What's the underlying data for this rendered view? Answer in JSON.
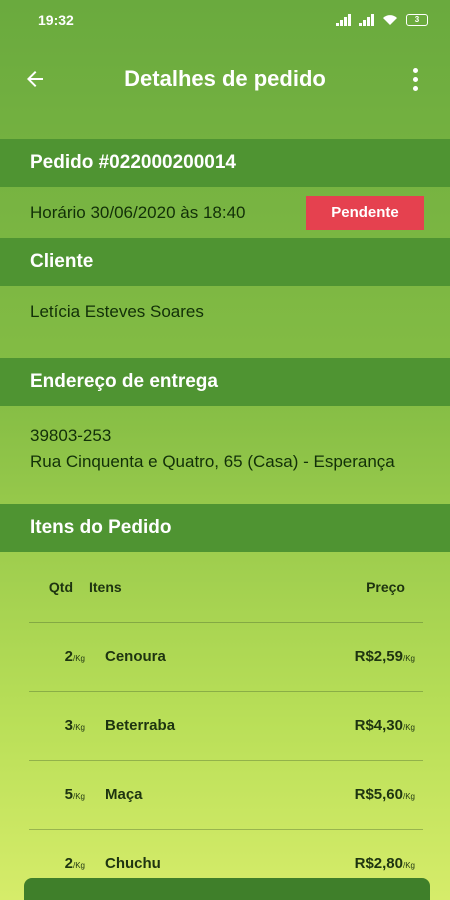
{
  "status_bar": {
    "time": "19:32",
    "battery": "3"
  },
  "app_bar": {
    "title": "Detalhes de pedido"
  },
  "order": {
    "title": "Pedido #022000200014",
    "time_label": "Horário 30/06/2020 às 18:40",
    "status": "Pendente",
    "status_color": "#e5414f"
  },
  "client": {
    "header": "Cliente",
    "name": "Letícia Esteves Soares"
  },
  "address": {
    "header": "Endereço de entrega",
    "zip": "39803-253",
    "street": "Rua Cinquenta e Quatro, 65 (Casa) - Esperança"
  },
  "items": {
    "header": "Itens do Pedido",
    "columns": {
      "qtd": "Qtd",
      "item": "Itens",
      "price": "Preço"
    },
    "rows": [
      {
        "qtd": "2",
        "unit": "/Kg",
        "name": "Cenoura",
        "price": "R$2,59",
        "price_unit": "/Kg"
      },
      {
        "qtd": "3",
        "unit": "/Kg",
        "name": "Beterraba",
        "price": "R$4,30",
        "price_unit": "/Kg"
      },
      {
        "qtd": "5",
        "unit": "/Kg",
        "name": "Maça",
        "price": "R$5,60",
        "price_unit": "/Kg"
      },
      {
        "qtd": "2",
        "unit": "/Kg",
        "name": "Chuchu",
        "price": "R$2,80",
        "price_unit": "/Kg"
      }
    ]
  },
  "colors": {
    "accent": "#4f9432",
    "button": "#3f7f2a"
  }
}
